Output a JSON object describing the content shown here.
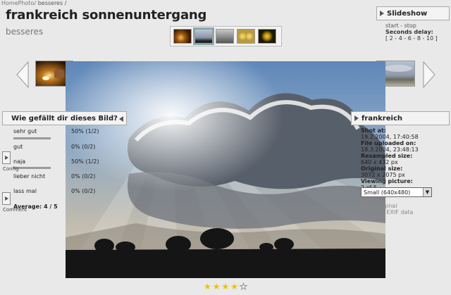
{
  "breadcrumb": {
    "parent": "HomePhoto/",
    "current": "besseres /"
  },
  "title": "frankreich sonnenuntergang",
  "subtitle": "besseres",
  "slideshow": {
    "title": "Slideshow",
    "start_stop": "start - stop",
    "delay_label": "Seconds delay:",
    "delay_options": "[ 2 - 4 - 6 - 8 - 10 ]"
  },
  "rating": {
    "title": "Wie gefällt dir dieses Bild?",
    "votes": [
      {
        "label": "sehr gut",
        "value": "50% (1/2)",
        "fraction": 0.5
      },
      {
        "label": "gut",
        "value": "0% (0/2)",
        "fraction": 0
      },
      {
        "label": "naja",
        "value": "50% (1/2)",
        "fraction": 0.5
      },
      {
        "label": "lieber nicht",
        "value": "0% (0/2)",
        "fraction": 0
      },
      {
        "label": "lass mal",
        "value": "0% (0/2)",
        "fraction": 0
      }
    ],
    "average": "Average: 4 / 5",
    "stars": 4,
    "stars_max": 5
  },
  "side": {
    "config": "Config",
    "comment": "Comment"
  },
  "info": {
    "title": "frankreich",
    "shot_at_label": "Shot at:",
    "shot_at": "19.2.2004, 17:40:58",
    "uploaded_label": "File uploaded on:",
    "uploaded": "18.3.2004, 23:48:13",
    "resampled_label": "Resampled size:",
    "resampled": "640 x 432 px",
    "original_label": "Original size:",
    "original": "3072 x 2075 px",
    "viewing_label": "Viewing picture:",
    "viewing": "2 of 5",
    "size_select": "Small (640x480)",
    "view_original": "View original",
    "view_exif": "View full EXIF data"
  }
}
